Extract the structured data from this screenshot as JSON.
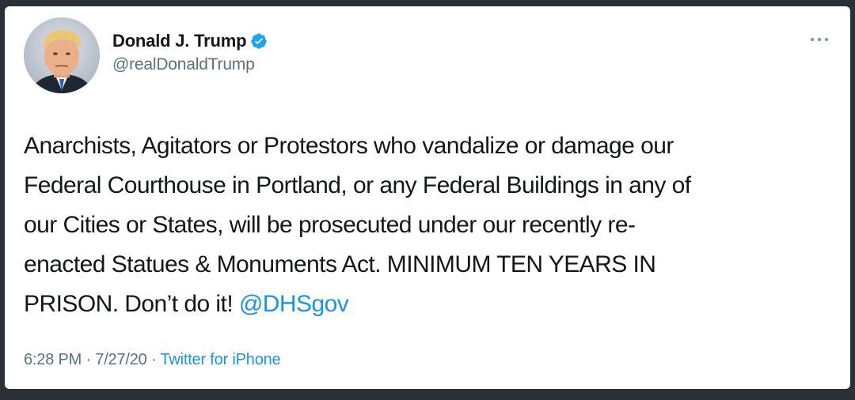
{
  "author": {
    "display_name": "Donald J. Trump",
    "handle": "@realDonaldTrump",
    "verified": true,
    "avatar_icon": "profile-photo"
  },
  "tweet": {
    "lines": [
      "Anarchists, Agitators or Protestors who vandalize or damage our",
      "Federal Courthouse in Portland, or any Federal Buildings in any of",
      "our Cities or States, will be prosecuted under our recently re-",
      "enacted Statues & Monuments Act. MINIMUM TEN YEARS IN"
    ],
    "last_line_text": "PRISON. Don’t do it! ",
    "mention": "@DHSgov"
  },
  "meta": {
    "time": "6:28 PM",
    "separator": " · ",
    "date": "7/27/20",
    "source": "Twitter for iPhone"
  },
  "icons": {
    "verified": "verified-badge-icon",
    "more": "more-options-icon"
  },
  "colors": {
    "link": "#1b95e0",
    "secondary_text": "#5b7083",
    "verified": "#1da1f2",
    "background": "#2b3036"
  }
}
